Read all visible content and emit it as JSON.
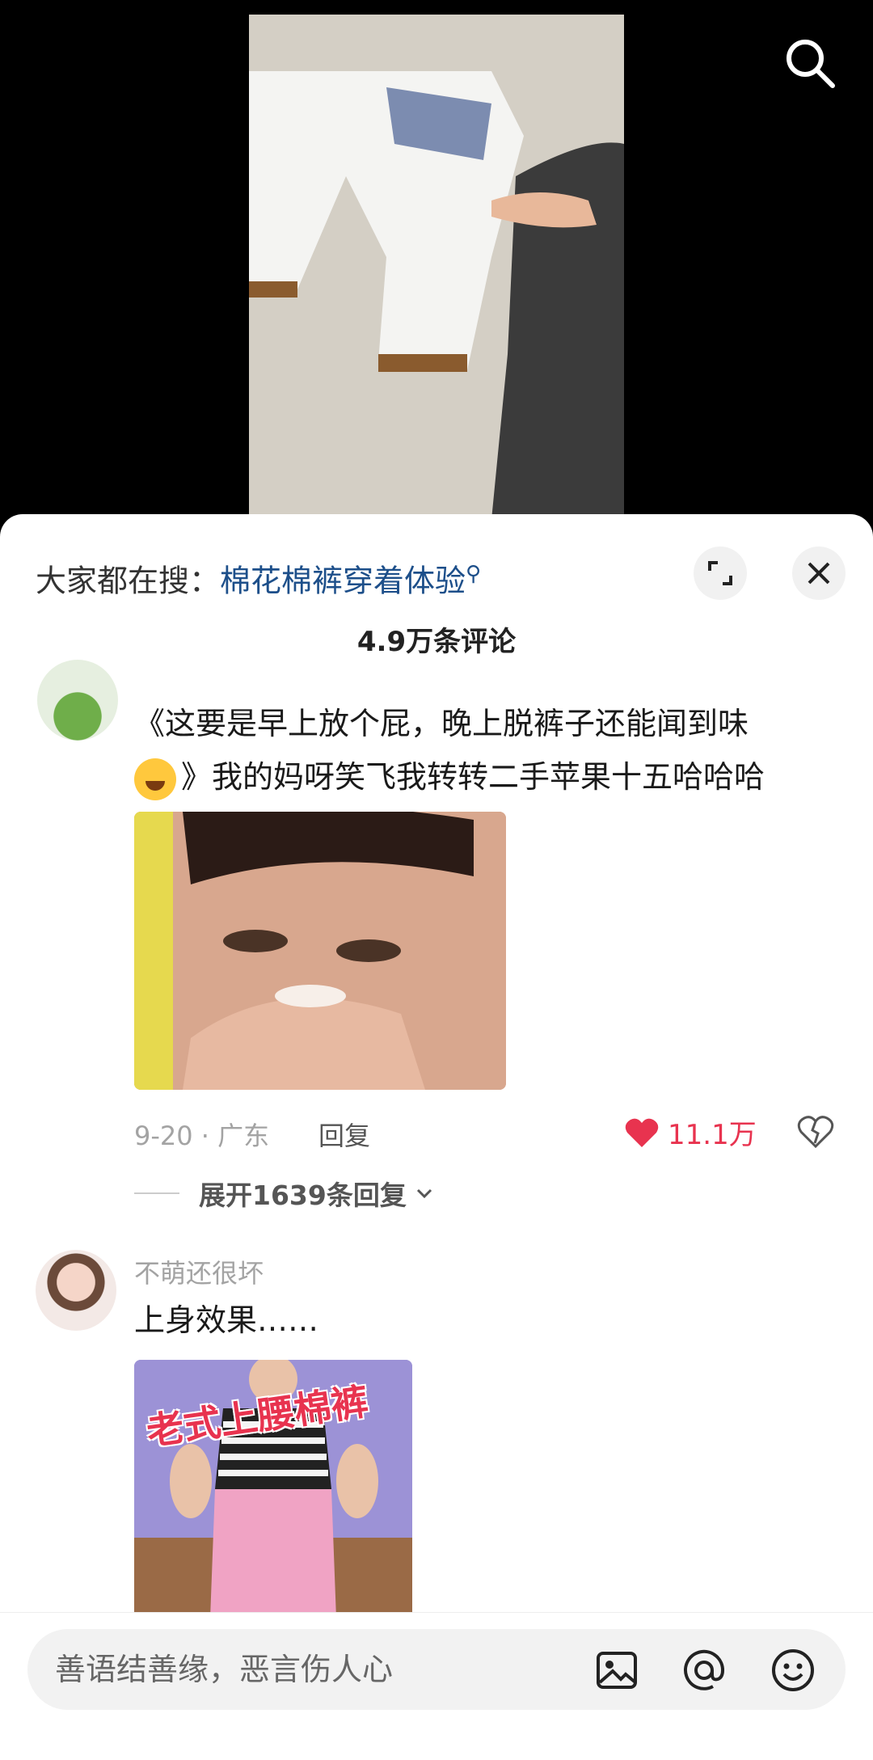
{
  "video": {
    "colors": {
      "background": "#000000"
    }
  },
  "hot_search": {
    "prefix": "大家都在搜：",
    "keyword": "棉花棉裤穿着体验",
    "keyword_color": "#1d4f8a"
  },
  "header": {
    "comment_count": "4.9万条评论"
  },
  "comments": [
    {
      "username": "",
      "text": "《这要是早上放个屁，晚上脱裤子还能闻到味",
      "text_cont": "》我的妈呀笑飞我转转二手苹果十五哈哈哈",
      "date_location": "9-20 · 广东",
      "reply_label": "回复",
      "likes": "11.1万",
      "expand_replies": "展开1639条回复"
    },
    {
      "username": "不萌还很坏",
      "text": "上身效果……",
      "image_caption": "老式上腰棉裤"
    }
  ],
  "input": {
    "placeholder": "善语结善缘，恶言伤人心"
  },
  "icons": {
    "search": "search-icon",
    "expand": "expand-icon",
    "close": "close-icon",
    "heart": "heart-icon",
    "dislike": "broken-heart-icon",
    "chevron": "chevron-down-icon",
    "image": "image-icon",
    "at": "at-icon",
    "emoji": "emoji-icon"
  },
  "colors": {
    "like_red": "#e8334f",
    "sheet_bg": "#ffffff"
  }
}
